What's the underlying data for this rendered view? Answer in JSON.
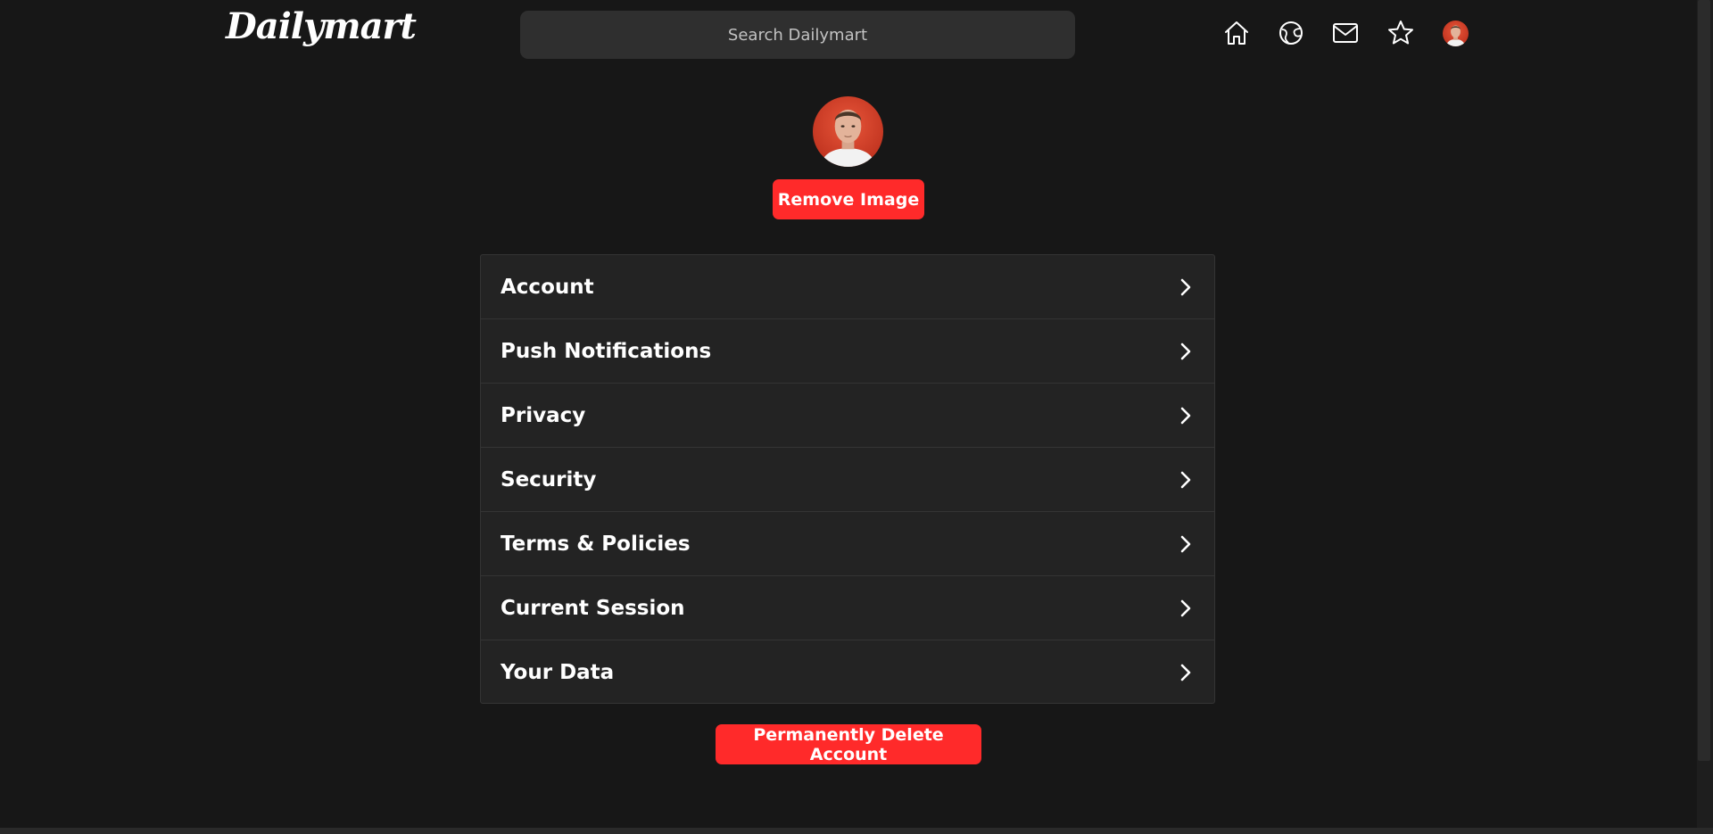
{
  "header": {
    "logo_text": "Dailymart",
    "search": {
      "placeholder": "Search Dailymart",
      "value": ""
    },
    "nav_icons": [
      "home-icon",
      "explore-icon",
      "mail-icon",
      "star-icon",
      "avatar"
    ]
  },
  "profile": {
    "remove_image_label": "Remove Image"
  },
  "settings": {
    "items": [
      {
        "label": "Account"
      },
      {
        "label": "Push Notifications"
      },
      {
        "label": "Privacy"
      },
      {
        "label": "Security"
      },
      {
        "label": "Terms & Policies"
      },
      {
        "label": "Current Session"
      },
      {
        "label": "Your Data"
      }
    ]
  },
  "danger": {
    "delete_label": "Permanently Delete Account"
  },
  "colors": {
    "background": "#171717",
    "panel": "#232323",
    "accent_red": "#ff2a2a",
    "search_bg": "#2f2f2f"
  }
}
